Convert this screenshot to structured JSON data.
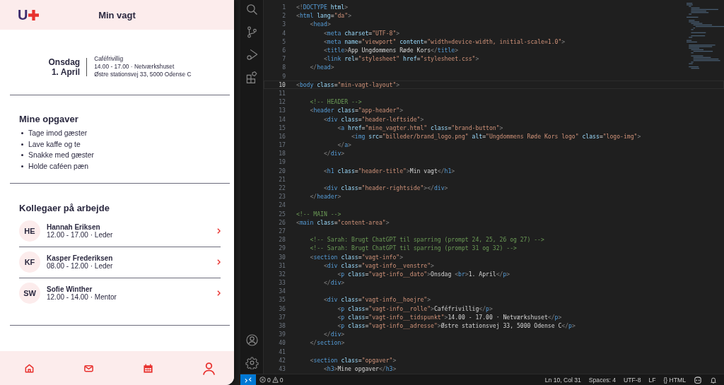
{
  "app": {
    "logo_letter": "U",
    "title": "Min vagt",
    "shift": {
      "date_lines": [
        "Onsdag",
        "1. April"
      ],
      "role": "Caféfrivillig",
      "time_place": "14.00 - 17.00 · Netværkshuset",
      "address": "Østre stationsvej 33, 5000 Odense C"
    },
    "tasks": {
      "heading": "Mine opgaver",
      "items": [
        "Tage imod gæster",
        "Lave kaffe og te",
        "Snakke med gæster",
        "Holde caféen pæn"
      ]
    },
    "colleagues": {
      "heading": "Kollegaer på arbejde",
      "items": [
        {
          "initials": "HE",
          "name": "Hannah Eriksen",
          "details": "12.00 - 17.00 · Leder"
        },
        {
          "initials": "KF",
          "name": "Kasper Frederiksen",
          "details": "08.00 - 12.00 · Leder"
        },
        {
          "initials": "SW",
          "name": "Sofie Winther",
          "details": "12.00 - 14.00 · Mentor"
        }
      ]
    },
    "nav": [
      {
        "selected": false
      },
      {
        "selected": false
      },
      {
        "selected": false
      },
      {
        "selected": false
      }
    ]
  },
  "editor": {
    "lines": [
      {
        "number": "1",
        "code": "<!DOCTYPE html>",
        "current": false
      },
      {
        "number": "2",
        "code": "<html lang=\"da\">",
        "current": false
      },
      {
        "number": "3",
        "code": "    <head>",
        "current": false
      },
      {
        "number": "4",
        "code": "        <meta charset=\"UTF-8\">",
        "current": false
      },
      {
        "number": "5",
        "code": "        <meta name=\"viewport\" content=\"width=device-width, initial-scale=1.0\">",
        "current": false
      },
      {
        "number": "6",
        "code": "        <title>App Ungdommens Røde Kors</title>",
        "current": false
      },
      {
        "number": "7",
        "code": "        <link rel=\"stylesheet\" href=\"stylesheet.css\">",
        "current": false
      },
      {
        "number": "8",
        "code": "    </head>",
        "current": false
      },
      {
        "number": "9",
        "current": false
      },
      {
        "number": "10",
        "code": "<body class=\"min-vagt-layout\">",
        "current": true
      },
      {
        "number": "11",
        "current": false
      },
      {
        "number": "12",
        "code": "    <!-- HEADER -->",
        "current": false
      },
      {
        "number": "13",
        "code": "    <header class=\"app-header\">",
        "current": false
      },
      {
        "number": "14",
        "code": "        <div class=\"header-leftside\">",
        "current": false
      },
      {
        "number": "15",
        "code": "            <a href=\"mine_vagter.html\" class=\"brand-button\">",
        "current": false
      },
      {
        "number": "16",
        "code": "                <img src=\"billeder/brand_logo.png\" alt=\"Ungdommens Røde Kors logo\" class=\"logo-img\">",
        "current": false
      },
      {
        "number": "17",
        "code": "            </a>",
        "current": false
      },
      {
        "number": "18",
        "code": "        </div>",
        "current": false
      },
      {
        "number": "19",
        "current": false
      },
      {
        "number": "20",
        "code": "        <h1 class=\"header-title\">Min vagt</h1>",
        "current": false
      },
      {
        "number": "21",
        "current": false
      },
      {
        "number": "22",
        "code": "        <div class=\"header-rightside\"></div>",
        "current": false
      },
      {
        "number": "23",
        "code": "    </header>",
        "current": false
      },
      {
        "number": "24",
        "current": false
      },
      {
        "number": "25",
        "code": "<!-- MAIN -->",
        "current": false
      },
      {
        "number": "26",
        "code": "<main class=\"content-area\">",
        "current": false
      },
      {
        "number": "27",
        "current": false
      },
      {
        "number": "28",
        "code": "    <!-- Sarah: Brugt ChatGPT til sparring (prompt 24, 25, 26 og 27) -->",
        "current": false
      },
      {
        "number": "29",
        "code": "    <!-- Sarah: Brugt ChatGPT til sparring (prompt 31 og 32) -->",
        "current": false
      },
      {
        "number": "30",
        "code": "    <section class=\"vagt-info\">",
        "current": false
      },
      {
        "number": "31",
        "code": "        <div class=\"vagt-info__venstre\">",
        "current": false
      },
      {
        "number": "32",
        "code": "            <p class=\"vagt-info__dato\">Onsdag <br>1. April</p>",
        "current": false
      },
      {
        "number": "33",
        "code": "        </div>",
        "current": false
      },
      {
        "number": "34",
        "current": false
      },
      {
        "number": "35",
        "code": "        <div class=\"vagt-info__hoejre\">",
        "current": false
      },
      {
        "number": "36",
        "code": "            <p class=\"vagt-info__rolle\">Caféfrivillig</p>",
        "current": false
      },
      {
        "number": "37",
        "code": "            <p class=\"vagt-info__tidspunkt\">14.00 - 17.00 · Netværkshuset</p>",
        "current": false
      },
      {
        "number": "38",
        "code": "            <p class=\"vagt-info__adresse\">Østre stationsvej 33, 5000 Odense C</p>",
        "current": false
      },
      {
        "number": "39",
        "code": "        </div>",
        "current": false
      },
      {
        "number": "40",
        "code": "    </section>",
        "current": false
      },
      {
        "number": "41",
        "current": false
      },
      {
        "number": "42",
        "code": "    <section class=\"opgaver\">",
        "current": false
      },
      {
        "number": "43",
        "code": "        <h3>Mine opgaver</h3>",
        "current": false
      }
    ]
  },
  "status_bar": {
    "errors": "0",
    "warnings": "0",
    "position": "Ln 10, Col 31",
    "indent": "Spaces: 4",
    "encoding": "UTF-8",
    "eol": "LF",
    "language_icon": "{}",
    "language": "HTML"
  }
}
